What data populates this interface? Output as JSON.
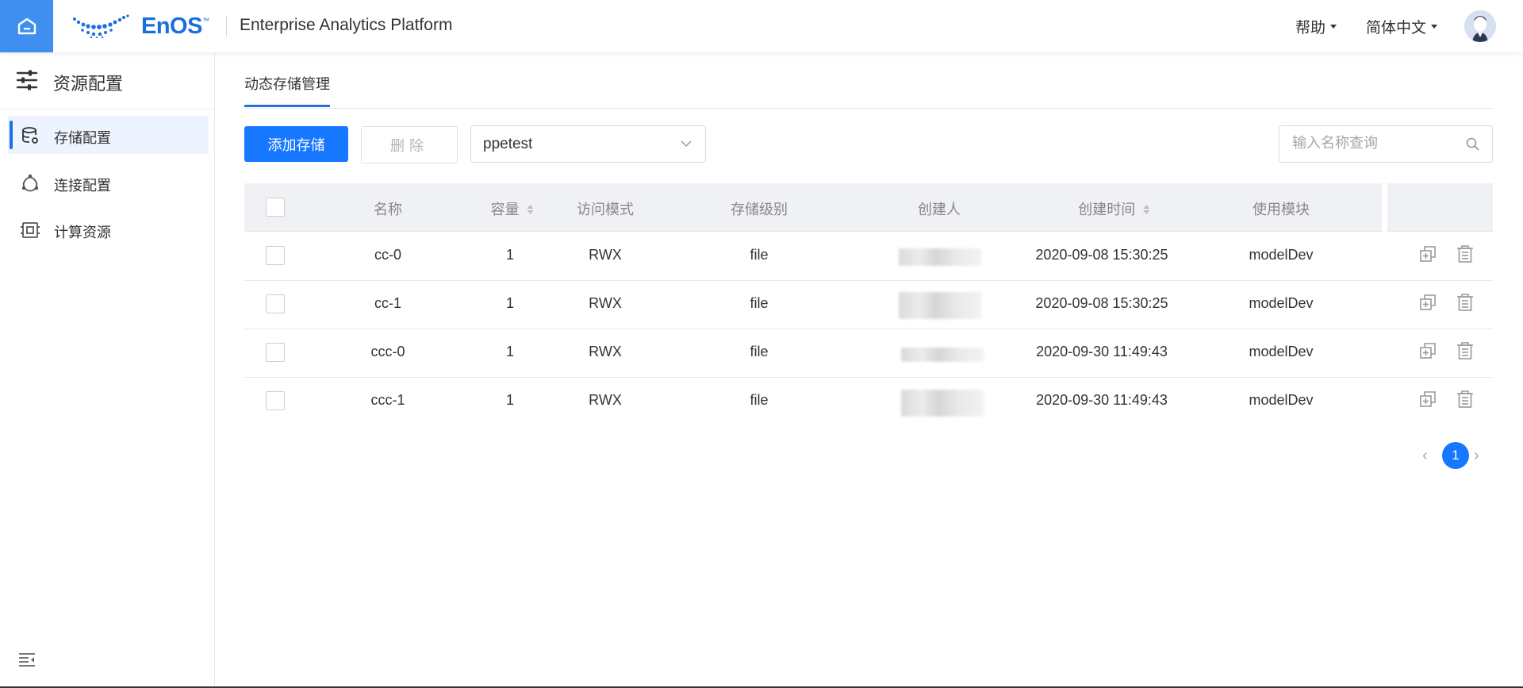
{
  "header": {
    "logo_text": "EnOS",
    "logo_tm": "™",
    "platform_title": "Enterprise Analytics Platform",
    "help_label": "帮助",
    "language_label": "简体中文"
  },
  "sidebar": {
    "title": "资源配置",
    "items": [
      {
        "label": "存储配置",
        "icon": "database-icon",
        "active": true
      },
      {
        "label": "连接配置",
        "icon": "connection-icon",
        "active": false
      },
      {
        "label": "计算资源",
        "icon": "cpu-icon",
        "active": false
      }
    ]
  },
  "main": {
    "tab_label": "动态存储管理",
    "toolbar": {
      "add_label": "添加存储",
      "delete_label": "删除",
      "select_value": "ppetest",
      "search_placeholder": "输入名称查询"
    },
    "table": {
      "columns": [
        "名称",
        "容量",
        "访问模式",
        "存储级别",
        "创建人",
        "创建时间",
        "使用模块"
      ],
      "rows": [
        {
          "name": "cc-0",
          "capacity": "1",
          "access": "RWX",
          "level": "file",
          "time": "2020-09-08 15:30:25",
          "module": "modelDev"
        },
        {
          "name": "cc-1",
          "capacity": "1",
          "access": "RWX",
          "level": "file",
          "time": "2020-09-08 15:30:25",
          "module": "modelDev"
        },
        {
          "name": "ccc-0",
          "capacity": "1",
          "access": "RWX",
          "level": "file",
          "time": "2020-09-30 11:49:43",
          "module": "modelDev"
        },
        {
          "name": "ccc-1",
          "capacity": "1",
          "access": "RWX",
          "level": "file",
          "time": "2020-09-30 11:49:43",
          "module": "modelDev"
        }
      ]
    },
    "pagination": {
      "current_page": "1",
      "prev": "‹",
      "next": "›"
    }
  },
  "colors": {
    "accent": "#1677ff",
    "home_bg": "#3f8ff0",
    "header_bg": "#f0f1f5"
  }
}
